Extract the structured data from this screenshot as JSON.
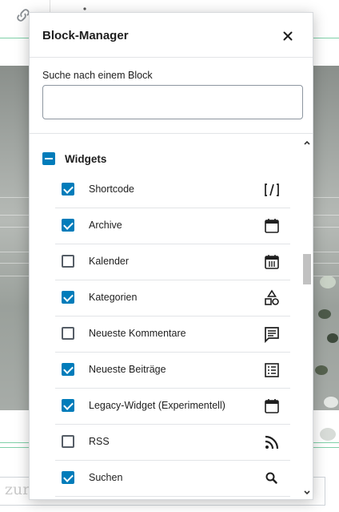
{
  "modal": {
    "title": "Block-Manager",
    "close_icon": "close-icon",
    "search": {
      "label": "Suche nach einem Block",
      "value": "",
      "placeholder": ""
    }
  },
  "category": {
    "label": "Widgets",
    "state": "partially-checked",
    "items": [
      {
        "label": "Shortcode",
        "checked": true,
        "icon": "shortcode-icon"
      },
      {
        "label": "Archive",
        "checked": true,
        "icon": "calendar-icon"
      },
      {
        "label": "Kalender",
        "checked": false,
        "icon": "calendar-grid-icon"
      },
      {
        "label": "Kategorien",
        "checked": true,
        "icon": "shapes-icon"
      },
      {
        "label": "Neueste Kommentare",
        "checked": false,
        "icon": "comment-icon"
      },
      {
        "label": "Neueste Beiträge",
        "checked": true,
        "icon": "list-icon"
      },
      {
        "label": "Legacy-Widget (Experimentell)",
        "checked": true,
        "icon": "calendar-icon"
      },
      {
        "label": "RSS",
        "checked": false,
        "icon": "rss-icon"
      },
      {
        "label": "Suchen",
        "checked": true,
        "icon": "search-icon"
      }
    ]
  },
  "background": {
    "bottom_text": "zur"
  },
  "colors": {
    "accent": "#007cba",
    "guide_line": "#7fd0a8"
  }
}
